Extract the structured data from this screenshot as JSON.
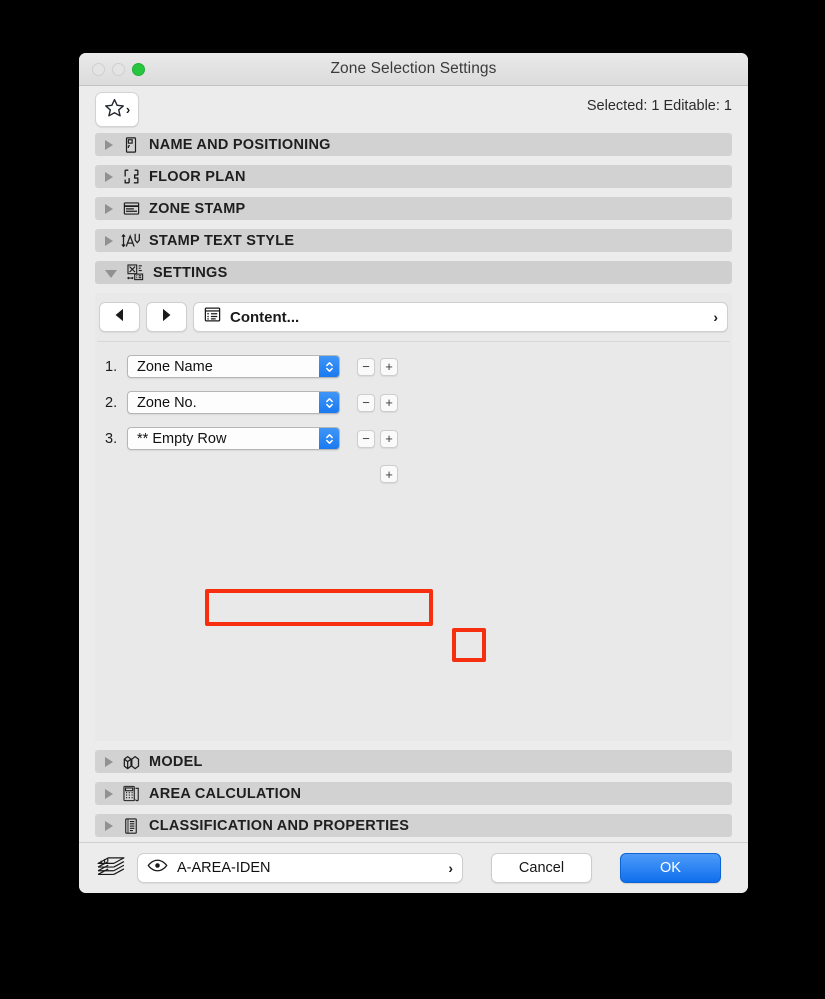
{
  "window": {
    "title": "Zone Selection Settings",
    "traffic_lights": [
      "close",
      "minimize",
      "zoom"
    ],
    "zoom_color": "#28c63f"
  },
  "toolbar": {
    "favorites_icon": "star-icon",
    "favorites_chevron": "›",
    "status_text": "Selected: 1 Editable: 1"
  },
  "sections_top": [
    {
      "label": "NAME AND POSITIONING",
      "icon": "door-panel-icon",
      "expanded": false
    },
    {
      "label": "FLOOR PLAN",
      "icon": "floor-plan-icon",
      "expanded": false
    },
    {
      "label": "ZONE STAMP",
      "icon": "zone-stamp-icon",
      "expanded": false
    },
    {
      "label": "STAMP TEXT STYLE",
      "icon": "text-style-icon",
      "expanded": false
    },
    {
      "label": "SETTINGS",
      "icon": "settings-grid-icon",
      "expanded": true
    }
  ],
  "settings_pane": {
    "nav": {
      "prev_icon": "triangle-left-icon",
      "next_icon": "triangle-right-icon",
      "page_icon": "list-content-icon",
      "page_label": "Content...",
      "disclosure_chevron": "›"
    },
    "rows": [
      {
        "number": "1.",
        "value": "Zone Name",
        "highlighted": false,
        "minus": "−",
        "plus": "+"
      },
      {
        "number": "2.",
        "value": "Zone No.",
        "highlighted": false,
        "minus": "−",
        "plus": "+"
      },
      {
        "number": "3.",
        "value": "** Empty Row",
        "highlighted": true,
        "minus": "−",
        "plus": "+"
      }
    ],
    "add_row": {
      "plus": "+",
      "highlighted": true
    }
  },
  "sections_bottom": [
    {
      "label": "MODEL",
      "icon": "cube-model-icon",
      "expanded": false
    },
    {
      "label": "AREA CALCULATION",
      "icon": "calculator-icon",
      "expanded": false
    },
    {
      "label": "CLASSIFICATION AND PROPERTIES",
      "icon": "document-list-icon",
      "expanded": false
    }
  ],
  "footer": {
    "layers_icon": "layers-stack-icon",
    "visibility_icon": "eye-icon",
    "layer_name": "A-AREA-IDEN",
    "layer_chevron": "›",
    "cancel_label": "Cancel",
    "ok_label": "OK"
  },
  "annotations": {
    "highlight_color": "#f62f0e",
    "boxes": [
      "row-3-popup",
      "add-row-plus-button"
    ]
  }
}
